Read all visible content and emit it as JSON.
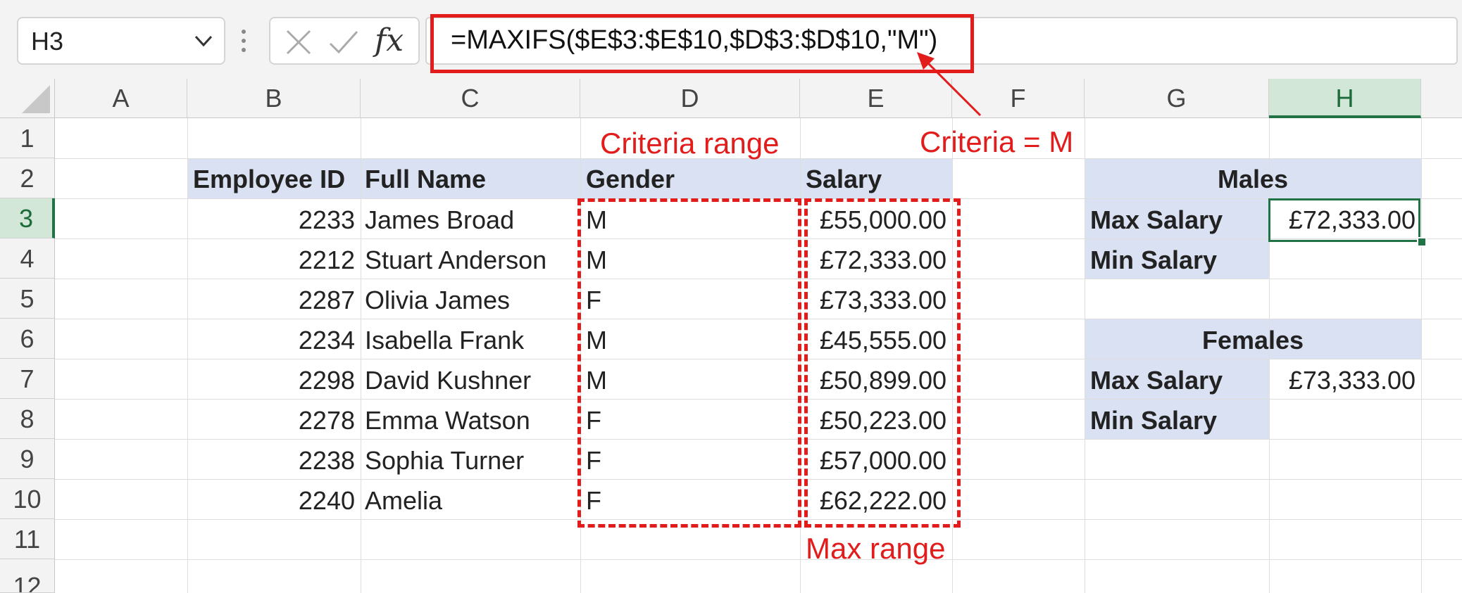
{
  "formula_bar": {
    "name_box": "H3",
    "fx_label": "fx",
    "formula": "=MAXIFS($E$3:$E$10,$D$3:$D$10,\"M\")"
  },
  "columns": [
    "A",
    "B",
    "C",
    "D",
    "E",
    "F",
    "G",
    "H"
  ],
  "rows": [
    "1",
    "2",
    "3",
    "4",
    "5",
    "6",
    "7",
    "8",
    "9",
    "10",
    "11",
    "12"
  ],
  "table": {
    "headers": [
      "Employee ID",
      "Full Name",
      "Gender",
      "Salary"
    ],
    "rows": [
      [
        "2233",
        "James Broad",
        "M",
        "£55,000.00"
      ],
      [
        "2212",
        "Stuart Anderson",
        "M",
        "£72,333.00"
      ],
      [
        "2287",
        "Olivia James",
        "F",
        "£73,333.00"
      ],
      [
        "2234",
        "Isabella Frank",
        "M",
        "£45,555.00"
      ],
      [
        "2298",
        "David Kushner",
        "M",
        "£50,899.00"
      ],
      [
        "2278",
        "Emma Watson",
        "F",
        "£50,223.00"
      ],
      [
        "2238",
        "Sophia Turner",
        "F",
        "£57,000.00"
      ],
      [
        "2240",
        "Amelia",
        "F",
        "£62,222.00"
      ]
    ]
  },
  "summary": {
    "males": {
      "title": "Males",
      "max_label": "Max Salary",
      "max_value": "£72,333.00",
      "min_label": "Min Salary",
      "min_value": ""
    },
    "females": {
      "title": "Females",
      "max_label": "Max Salary",
      "max_value": "£73,333.00",
      "min_label": "Min Salary",
      "min_value": ""
    }
  },
  "annotations": {
    "criteria_range": "Criteria range",
    "criteria": "Criteria = M",
    "max_range": "Max range"
  },
  "colors": {
    "annotation_red": "#e21b1b",
    "header_fill": "#d9e1f2",
    "selection_green": "#217346"
  }
}
